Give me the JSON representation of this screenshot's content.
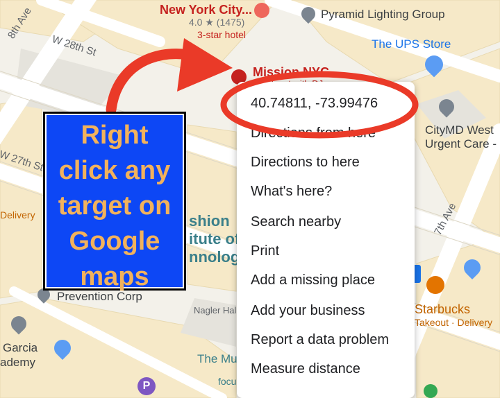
{
  "map": {
    "streets": {
      "eighth_ave": "8th Ave",
      "w28": "W 28th St",
      "w27": "W 27th St",
      "seventh_ave": "7th Ave"
    },
    "places": {
      "hotel_name": "New York City...",
      "hotel_rating": "4.0 ★ (1475)",
      "hotel_class": "3-star hotel",
      "pyramid": "Pyramid Lighting Group",
      "ups": "The UPS Store",
      "mission": "Mission NYC",
      "mission_sub": "Nightspot with DJ",
      "citymd_1": "CityMD West",
      "citymd_2": "Urgent Care -",
      "delivery_left": "Delivery",
      "fit_1": "shion",
      "fit_2": "itute of",
      "fit_3": "nnology",
      "prevention": "Prevention Corp",
      "nagler": "Nagler Hall",
      "garcia_1": "Garcia",
      "garcia_2": "ademy",
      "museum": "The Mu",
      "focus": "focu",
      "starbucks": "Starbucks",
      "starbucks_sub": "Takeout · Delivery",
      "parking": "P"
    }
  },
  "context_menu": {
    "coordinates": "40.74811, -73.99476",
    "items": [
      "Directions from here",
      "Directions to here",
      "What's here?",
      "Search nearby",
      "Print",
      "Add a missing place",
      "Add your business",
      "Report a data problem",
      "Measure distance"
    ]
  },
  "callout": {
    "lines": [
      "Right",
      "click any",
      "target on",
      "Google",
      "maps"
    ],
    "text_color": "#f2b25c",
    "background": "#0d47f5"
  },
  "annotation": {
    "color": "#ea3a28"
  }
}
